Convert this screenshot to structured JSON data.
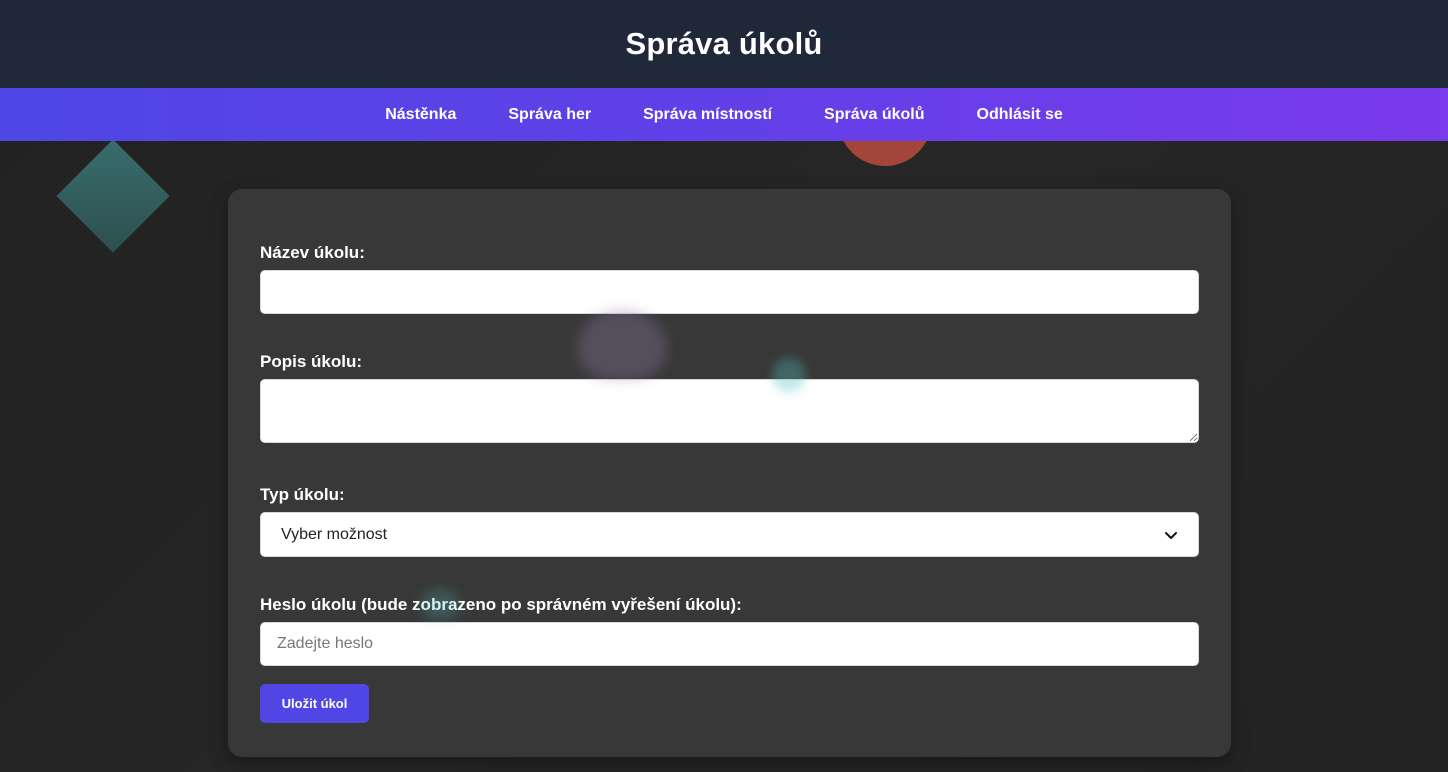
{
  "header": {
    "title": "Správa úkolů"
  },
  "nav": {
    "items": [
      {
        "label": "Nástěnka"
      },
      {
        "label": "Správa her"
      },
      {
        "label": "Správa místností"
      },
      {
        "label": "Správa úkolů"
      },
      {
        "label": "Odhlásit se"
      }
    ]
  },
  "form": {
    "name_label": "Název úkolu:",
    "name_value": "",
    "description_label": "Popis úkolu:",
    "description_value": "",
    "type_label": "Typ úkolu:",
    "type_selected": "Vyber možnost",
    "password_label": "Heslo úkolu (bude zobrazeno po správném vyřešení úkolu):",
    "password_placeholder": "Zadejte heslo",
    "save_label": "Uložit úkol"
  },
  "colors": {
    "header_bg": "#1e2638",
    "nav_gradient_start": "#4f46e5",
    "nav_gradient_end": "#7b3aec",
    "card_bg": "#383838",
    "button_bg": "#4f46e5"
  }
}
